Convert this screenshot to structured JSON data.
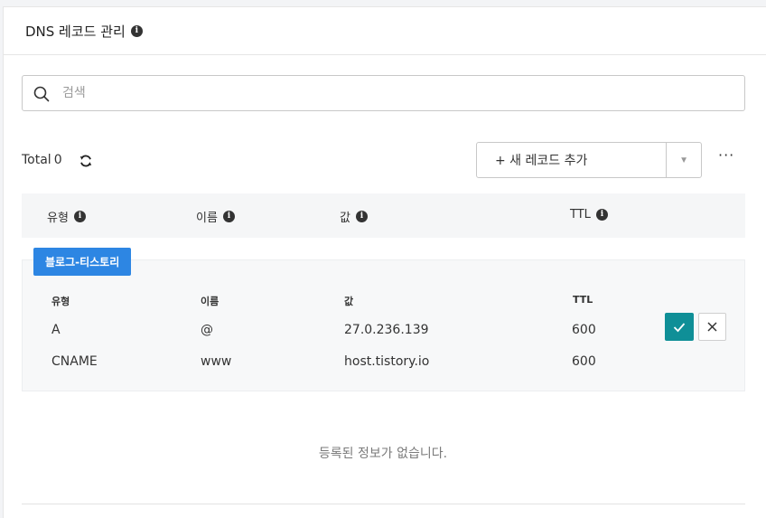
{
  "header": {
    "title": "DNS 레코드 관리",
    "info_icon": "info-icon"
  },
  "search": {
    "placeholder": "검색",
    "value": ""
  },
  "toolbar": {
    "total_label": "Total",
    "total_count": "0",
    "add_label": "+ 새 레코드 추가",
    "more_label": "···"
  },
  "table": {
    "headers": [
      "유형",
      "이름",
      "값",
      "TTL"
    ]
  },
  "group": {
    "tag": "블로그-티스토리",
    "columns": [
      "유형",
      "이름",
      "값",
      "TTL"
    ],
    "rows": [
      {
        "type": "A",
        "name": "@",
        "value": "27.0.236.139",
        "ttl": "600"
      },
      {
        "type": "CNAME",
        "name": "www",
        "value": "host.tistory.io",
        "ttl": "600"
      }
    ],
    "confirm_color": "#0f8f97",
    "tag_color": "#2d86e3"
  },
  "empty": {
    "message": "등록된 정보가 없습니다."
  }
}
